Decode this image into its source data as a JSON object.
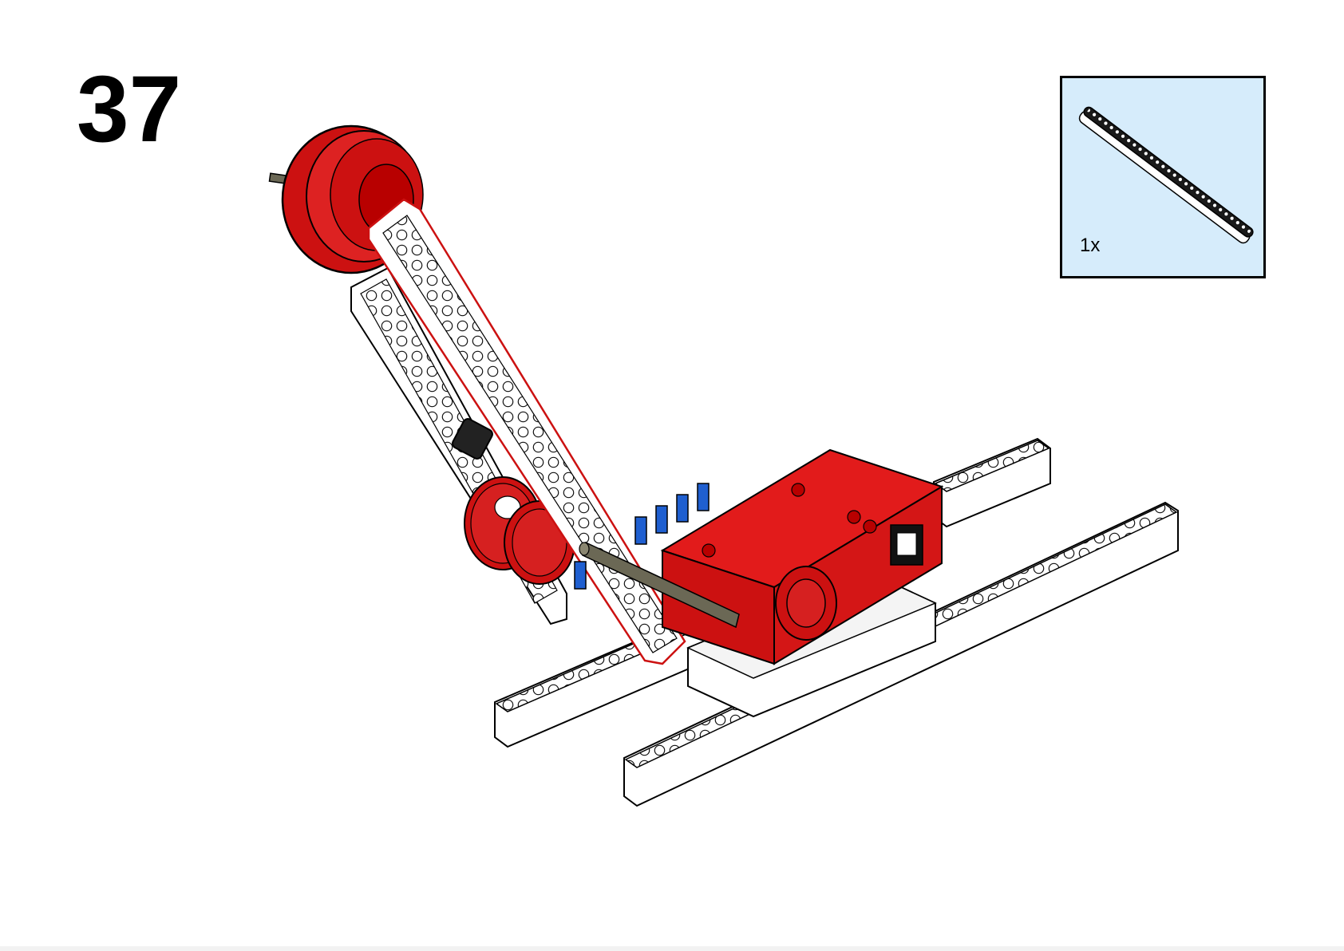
{
  "step": {
    "number": "37"
  },
  "parts_list": {
    "items": [
      {
        "icon": "liftarm-beam-icon",
        "quantity": "1x"
      }
    ]
  },
  "colors": {
    "callout_background": "#d6ecfb",
    "brick_red": "#cc1111",
    "beam_white": "#ffffff",
    "connector_blue": "#1f5fd0",
    "axle_gray": "#6b6855"
  }
}
